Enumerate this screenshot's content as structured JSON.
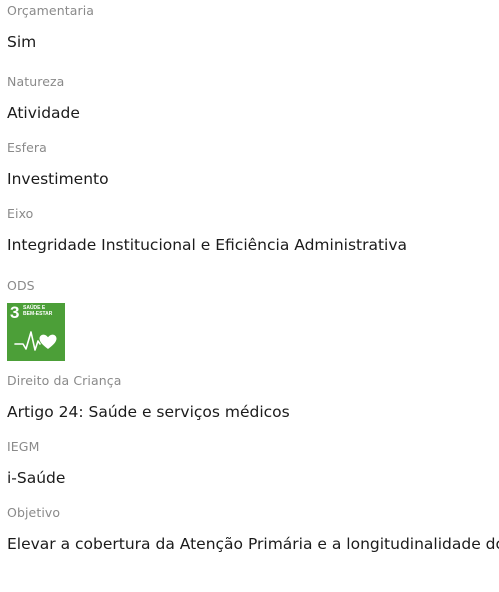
{
  "fields": [
    {
      "label": "Orçamentaria",
      "value": "Sim"
    },
    {
      "label": "Natureza",
      "value": "Atividade"
    },
    {
      "label": "Esfera",
      "value": "Investimento"
    },
    {
      "label": "Eixo",
      "value": "Integridade Institucional e Eficiência Administrativa"
    }
  ],
  "ods": {
    "label": "ODS",
    "tile": {
      "number": "3",
      "title_line1": "SAÚDE E",
      "title_line2": "BEM-ESTAR",
      "color": "#4c9f38",
      "icon": "heartbeat-heart-icon"
    }
  },
  "fields2": [
    {
      "label": "Direito da Criança",
      "value": "Artigo 24: Saúde e serviços médicos"
    },
    {
      "label": "IEGM",
      "value": "i-Saúde"
    },
    {
      "label": "Objetivo",
      "value": "Elevar a cobertura da Atenção Primária e a longitudinalidade do cuidado"
    }
  ]
}
